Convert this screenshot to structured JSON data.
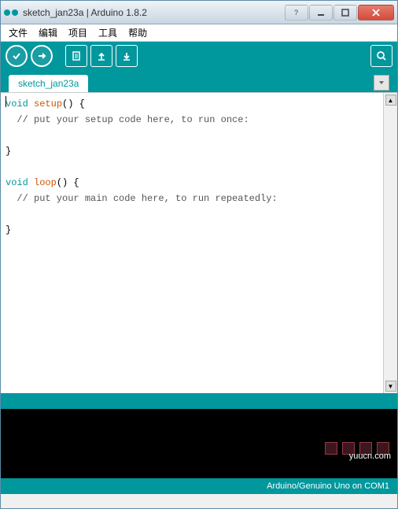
{
  "window": {
    "title": "sketch_jan23a | Arduino 1.8.2"
  },
  "menubar": {
    "file": "文件",
    "edit": "编辑",
    "project": "项目",
    "tools": "工具",
    "help": "帮助"
  },
  "tab": {
    "name": "sketch_jan23a"
  },
  "code": {
    "void1": "void",
    "setup": " setup",
    "open1": "() {",
    "comment1": "  // put your setup code here, to run once:",
    "blank1": "",
    "close1": "}",
    "blank2": "",
    "void2": "void",
    "loop": " loop",
    "open2": "() {",
    "comment2": "  // put your main code here, to run repeatedly:",
    "blank3": "",
    "close2": "}"
  },
  "status": {
    "text": "Arduino/Genuino Uno on COM1"
  },
  "watermark": {
    "text": "yuucn.com"
  }
}
